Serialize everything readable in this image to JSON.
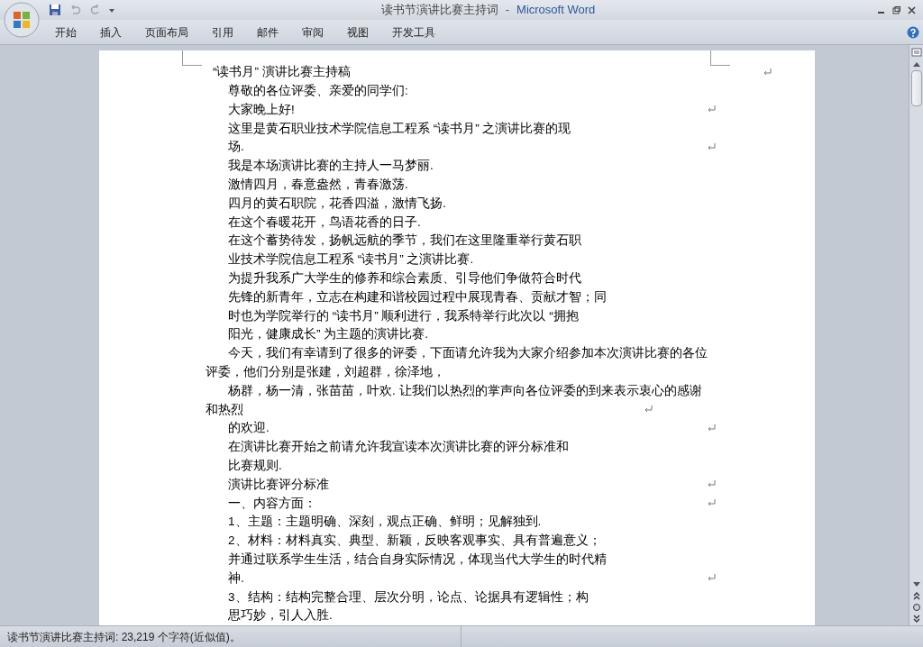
{
  "window": {
    "title": "读书节演讲比赛主持词",
    "separator": "-",
    "app": "Microsoft Word"
  },
  "ribbon_tabs": [
    {
      "label": "开始",
      "selected": false
    },
    {
      "label": "插入",
      "selected": false
    },
    {
      "label": "页面布局",
      "selected": false
    },
    {
      "label": "引用",
      "selected": false
    },
    {
      "label": "邮件",
      "selected": false
    },
    {
      "label": "审阅",
      "selected": false
    },
    {
      "label": "视图",
      "selected": false
    },
    {
      "label": "开发工具",
      "selected": false
    }
  ],
  "document": {
    "lines": [
      {
        "kind": "title",
        "text": "“读书月” 演讲比赛主持稿",
        "paragraph_mark": true
      },
      {
        "kind": "indent",
        "text": "尊敬的各位评委、亲爱的同学们:",
        "paragraph_mark": false
      },
      {
        "kind": "indent",
        "text": "大家晚上好!",
        "paragraph_mark": true
      },
      {
        "kind": "indent",
        "text": "这里是黄石职业技术学院信息工程系 “读书月” 之演讲比赛的现",
        "paragraph_mark": false
      },
      {
        "kind": "indent",
        "text": "场.",
        "paragraph_mark": true
      },
      {
        "kind": "indent",
        "text": "我是本场演讲比赛的主持人一马梦丽.",
        "paragraph_mark": false
      },
      {
        "kind": "indent",
        "text": "激情四月，春意盎然，青春激荡.",
        "paragraph_mark": false
      },
      {
        "kind": "indent",
        "text": "四月的黄石职院，花香四溢，激情飞扬.",
        "paragraph_mark": false
      },
      {
        "kind": "indent",
        "text": "在这个春暖花开，鸟语花香的日子.",
        "paragraph_mark": false
      },
      {
        "kind": "indent",
        "text": "在这个蓄势待发，扬帆远航的季节，我们在这里隆重举行黄石职",
        "paragraph_mark": false
      },
      {
        "kind": "indent",
        "text": "业技术学院信息工程系 “读书月” 之演讲比赛.",
        "paragraph_mark": false
      },
      {
        "kind": "indent",
        "text": "为提升我系广大学生的修养和综合素质、引导他们争做符合时代",
        "paragraph_mark": false
      },
      {
        "kind": "indent",
        "text": "先锋的新青年，立志在构建和谐校园过程中展现青春、贡献才智；同",
        "paragraph_mark": false
      },
      {
        "kind": "indent",
        "text": "时也为学院举行的 “读书月” 顺利进行，我系特举行此次以 “拥抱",
        "paragraph_mark": false
      },
      {
        "kind": "indent",
        "text": "阳光，健康成长” 为主题的演讲比赛.",
        "paragraph_mark": false
      },
      {
        "kind": "indent",
        "text": "今天，我们有幸请到了很多的评委，下面请允许我为大家介绍参加本次演讲比赛的各位",
        "paragraph_mark": false
      },
      {
        "kind": "flush",
        "text": "评委，他们分别是张建，刘超群，徐泽地，",
        "paragraph_mark": false
      },
      {
        "kind": "indent",
        "text": "杨群，杨一清，张苗苗，叶欢. 让我们以热烈的掌声向各位评委的到来表示衷心的感谢",
        "paragraph_mark": false
      },
      {
        "kind": "flush",
        "text": "和热烈",
        "paragraph_mark": true
      },
      {
        "kind": "indent",
        "text": "的欢迎.",
        "paragraph_mark": true
      },
      {
        "kind": "indent",
        "text": "在演讲比赛开始之前请允许我宣读本次演讲比赛的评分标准和",
        "paragraph_mark": false
      },
      {
        "kind": "indent",
        "text": "比赛规则.",
        "paragraph_mark": false
      },
      {
        "kind": "indent",
        "text": "演讲比赛评分标准",
        "paragraph_mark": true
      },
      {
        "kind": "indent",
        "text": "一、内容方面：",
        "paragraph_mark": true
      },
      {
        "kind": "indent",
        "text": "1、主题：主题明确、深刻，观点正确、鲜明；见解独到.",
        "paragraph_mark": false
      },
      {
        "kind": "indent",
        "text": "2、材料：材料真实、典型、新颖，反映客观事实、具有普遍意义；",
        "paragraph_mark": false
      },
      {
        "kind": "indent",
        "text": "并通过联系学生生活，结合自身实际情况，体现当代大学生的时代精",
        "paragraph_mark": false
      },
      {
        "kind": "indent",
        "text": "神.",
        "paragraph_mark": true
      },
      {
        "kind": "indent",
        "text": "3、结构：结构完整合理、层次分明，论点、论据具有逻辑性；构",
        "paragraph_mark": false
      },
      {
        "kind": "indent",
        "text": "思巧妙，引人入胜.",
        "paragraph_mark": false
      }
    ]
  },
  "status_bar": {
    "text": "读书节演讲比赛主持词: 23,219 个字符(近似值)。"
  }
}
